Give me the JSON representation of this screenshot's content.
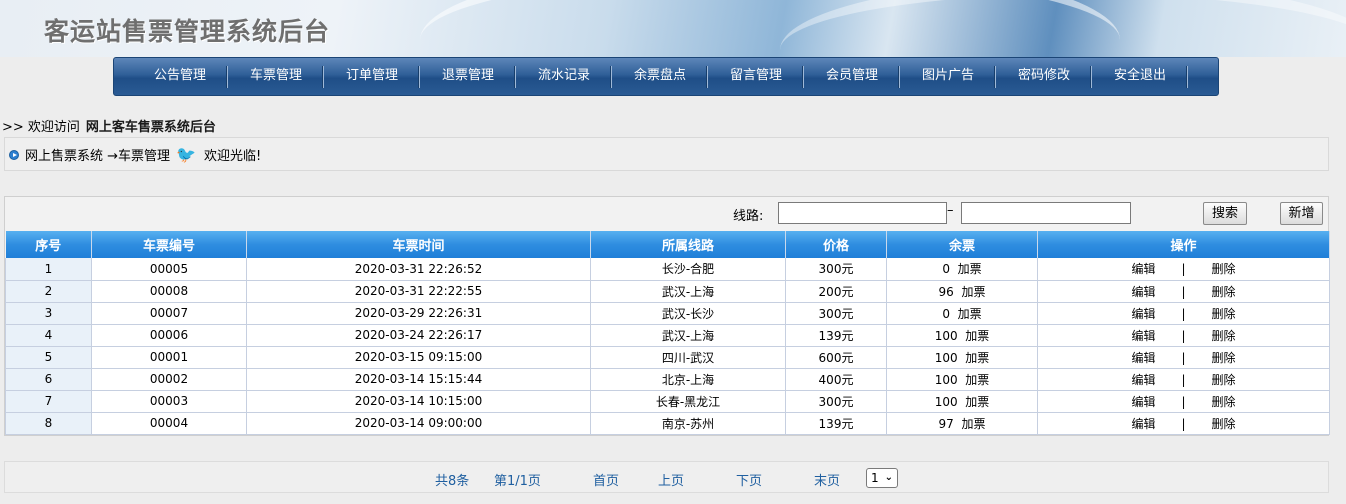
{
  "app": {
    "title": "客运站售票管理系统后台"
  },
  "nav": {
    "items": [
      "公告管理",
      "车票管理",
      "订单管理",
      "退票管理",
      "流水记录",
      "余票盘点",
      "留言管理",
      "会员管理",
      "图片广告",
      "密码修改",
      "安全退出"
    ]
  },
  "welcome": {
    "prefix": ">> 欢迎访问",
    "site": "网上客车售票系统后台"
  },
  "breadcrumb": {
    "path": "网上售票系统 →车票管理",
    "greeting": "欢迎光临!"
  },
  "search": {
    "label": "线路:",
    "dash": "–",
    "from_value": "",
    "to_value": "",
    "search_label": "搜索",
    "add_label": "新增"
  },
  "table": {
    "headers": [
      "序号",
      "车票编号",
      "车票时间",
      "所属线路",
      "价格",
      "余票",
      "操作"
    ],
    "rows": [
      {
        "idx": "1",
        "code": "00005",
        "time": "2020-03-31 22:26:52",
        "route": "长沙-合肥",
        "price": "300元",
        "remain": "0",
        "add": "加票",
        "edit": "编辑",
        "sep": "|",
        "del": "删除"
      },
      {
        "idx": "2",
        "code": "00008",
        "time": "2020-03-31 22:22:55",
        "route": "武汉-上海",
        "price": "200元",
        "remain": "96",
        "add": "加票",
        "edit": "编辑",
        "sep": "|",
        "del": "删除"
      },
      {
        "idx": "3",
        "code": "00007",
        "time": "2020-03-29 22:26:31",
        "route": "武汉-长沙",
        "price": "300元",
        "remain": "0",
        "add": "加票",
        "edit": "编辑",
        "sep": "|",
        "del": "删除"
      },
      {
        "idx": "4",
        "code": "00006",
        "time": "2020-03-24 22:26:17",
        "route": "武汉-上海",
        "price": "139元",
        "remain": "100",
        "add": "加票",
        "edit": "编辑",
        "sep": "|",
        "del": "删除"
      },
      {
        "idx": "5",
        "code": "00001",
        "time": "2020-03-15 09:15:00",
        "route": "四川-武汉",
        "price": "600元",
        "remain": "100",
        "add": "加票",
        "edit": "编辑",
        "sep": "|",
        "del": "删除"
      },
      {
        "idx": "6",
        "code": "00002",
        "time": "2020-03-14 15:15:44",
        "route": "北京-上海",
        "price": "400元",
        "remain": "100",
        "add": "加票",
        "edit": "编辑",
        "sep": "|",
        "del": "删除"
      },
      {
        "idx": "7",
        "code": "00003",
        "time": "2020-03-14 10:15:00",
        "route": "长春-黑龙江",
        "price": "300元",
        "remain": "100",
        "add": "加票",
        "edit": "编辑",
        "sep": "|",
        "del": "删除"
      },
      {
        "idx": "8",
        "code": "00004",
        "time": "2020-03-14 09:00:00",
        "route": "南京-苏州",
        "price": "139元",
        "remain": "97",
        "add": "加票",
        "edit": "编辑",
        "sep": "|",
        "del": "删除"
      }
    ]
  },
  "pager": {
    "total": "共8条",
    "page": "第1/1页",
    "first": "首页",
    "prev": "上页",
    "next": "下页",
    "last": "末页",
    "select_value": "1"
  }
}
